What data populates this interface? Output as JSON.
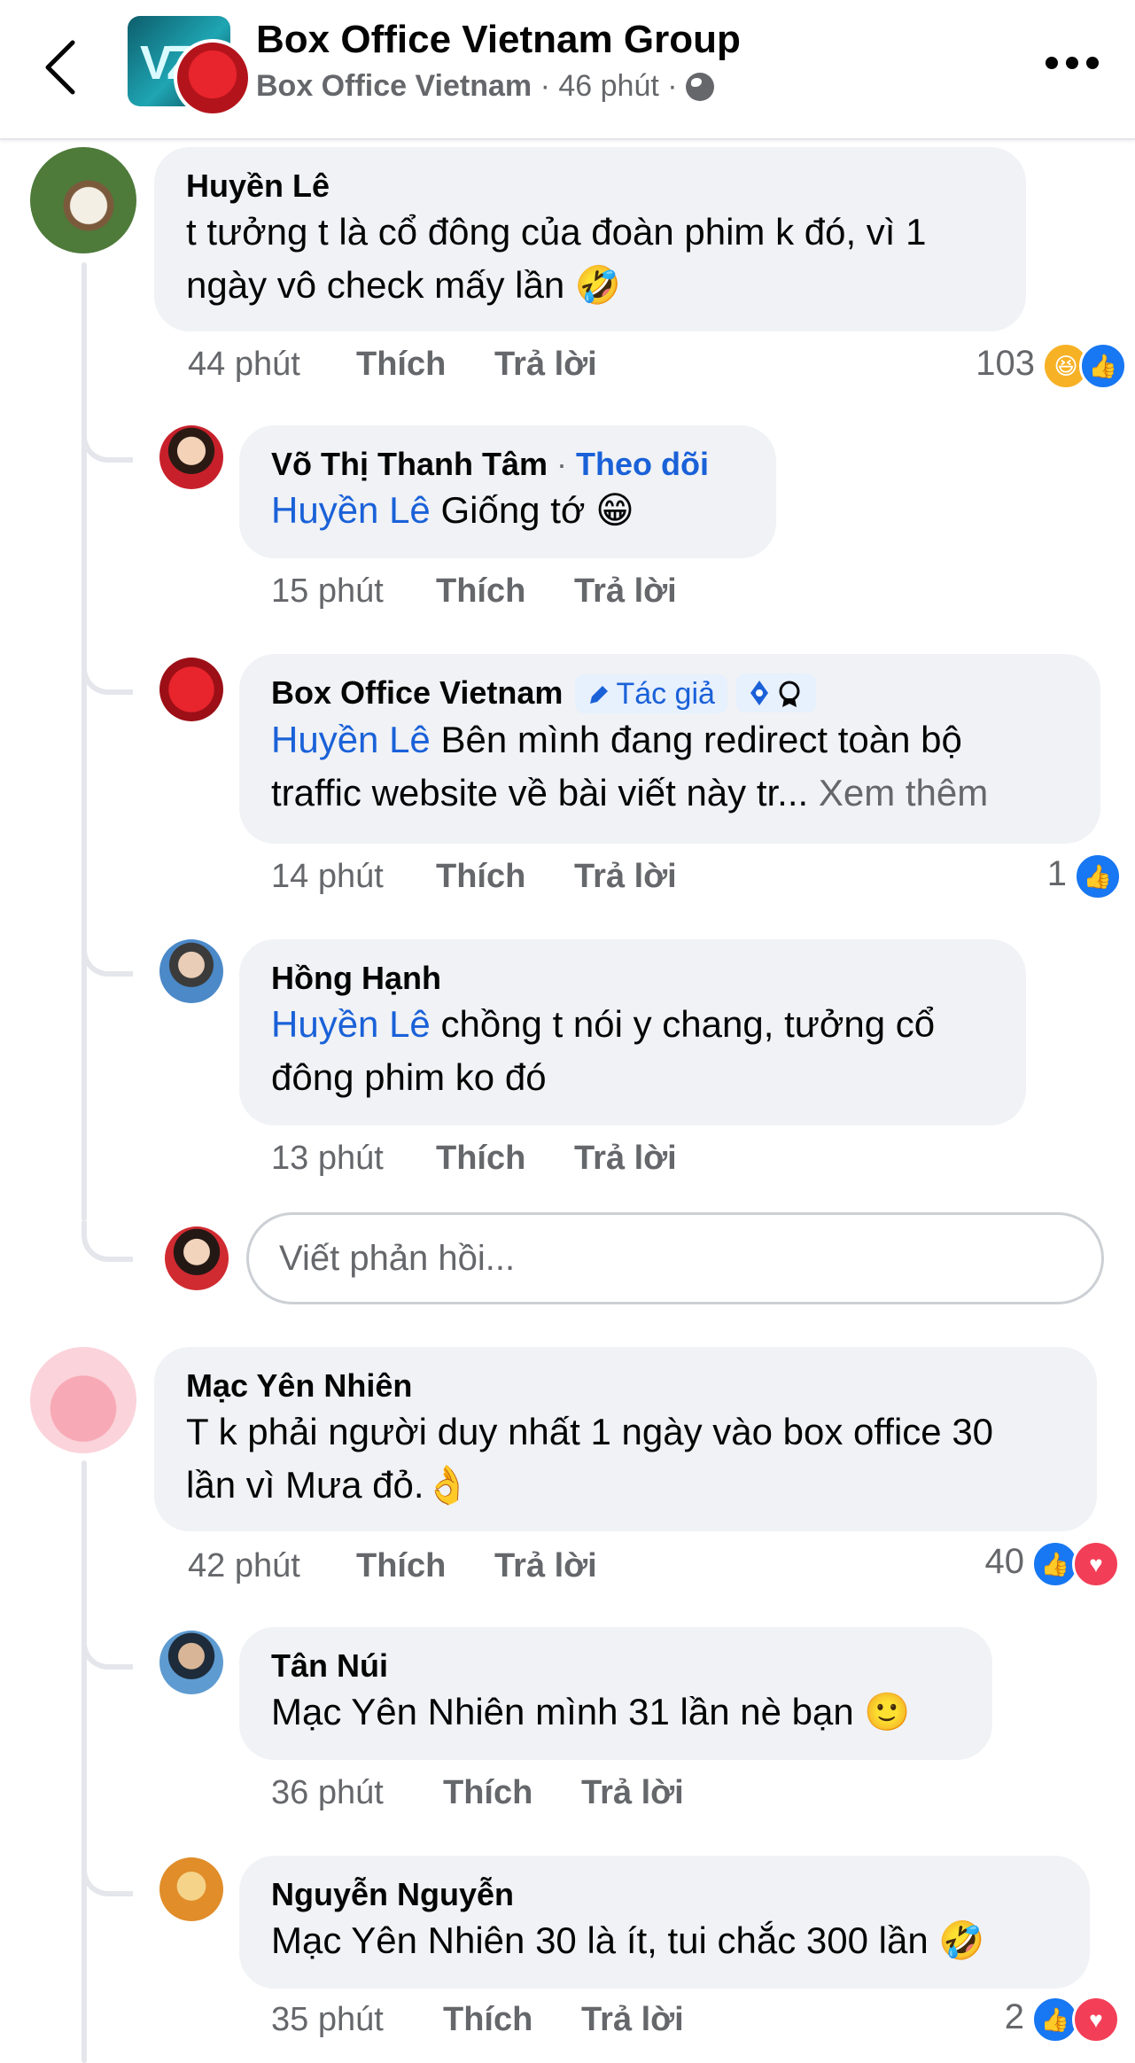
{
  "header": {
    "title": "Box Office Vietnam Group",
    "page_name": "Box Office Vietnam",
    "time": "46 phút"
  },
  "comments": [
    {
      "name": "Huyền Lê",
      "text": "t tưởng t là cổ đông của đoàn phim k đó, vì 1",
      "text2": "ngày vô check mấy lần 🤣",
      "time": "44 phút",
      "like": "Thích",
      "reply": "Trả lời",
      "reactions": "103",
      "replies": [
        {
          "name": "Võ Thị Thanh Tâm",
          "follow": "Theo dõi",
          "mention": "Huyền Lê",
          "text": "Giống tớ 😁",
          "time": "15 phút",
          "like": "Thích",
          "reply": "Trả lời"
        },
        {
          "name": "Box Office Vietnam",
          "author_badge": "Tác giả",
          "mention": "Huyền Lê",
          "text": "Bên mình đang redirect toàn bộ",
          "text2": "traffic website về bài viết này tr...",
          "see_more": "Xem thêm",
          "time": "14 phút",
          "like": "Thích",
          "reply": "Trả lời",
          "reactions": "1"
        },
        {
          "name": "Hồng Hạnh",
          "mention": "Huyền Lê",
          "text": "chồng t nói y chang, tưởng cổ",
          "text2": "đông phim ko đó",
          "time": "13 phút",
          "like": "Thích",
          "reply": "Trả lời"
        }
      ],
      "reply_placeholder": "Viết phản hồi..."
    },
    {
      "name": "Mạc Yên Nhiên",
      "text": "T k phải người duy nhất 1 ngày vào box office 30",
      "text2": "lần vì Mưa đỏ.👌",
      "time": "42 phút",
      "like": "Thích",
      "reply": "Trả lời",
      "reactions": "40",
      "replies": [
        {
          "name": "Tân Núi",
          "mention": "Mạc Yên Nhiên",
          "text": "mình 31 lần nè bạn 🙂",
          "time": "36 phút",
          "like": "Thích",
          "reply": "Trả lời"
        },
        {
          "name": "Nguyễn Nguyễn",
          "mention": "Mạc Yên Nhiên",
          "text": "30 là ít, tui chắc 300 lần 🤣",
          "time": "35 phút",
          "like": "Thích",
          "reply": "Trả lời",
          "reactions": "2"
        }
      ]
    }
  ],
  "icons": [
    "back-arrow-icon",
    "more-icon",
    "globe-icon",
    "pencil-icon",
    "like-icon",
    "love-icon",
    "haha-icon"
  ],
  "colors": {
    "accent": "#1a61d8",
    "bubble": "#f0f2f5",
    "meta": "#65676b",
    "like": "#1877f2",
    "love": "#f33e58"
  }
}
